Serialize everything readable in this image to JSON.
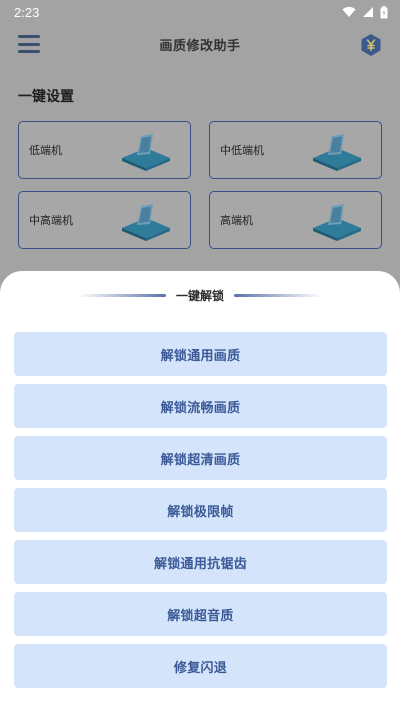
{
  "status_bar": {
    "time": "2:23"
  },
  "app_bar": {
    "title": "画质修改助手"
  },
  "section": {
    "title": "一键设置"
  },
  "devices": [
    {
      "label": "低端机"
    },
    {
      "label": "中低端机"
    },
    {
      "label": "中高端机"
    },
    {
      "label": "高端机"
    }
  ],
  "sheet": {
    "title": "一键解锁",
    "actions": [
      {
        "label": "解锁通用画质"
      },
      {
        "label": "解锁流畅画质"
      },
      {
        "label": "解锁超清画质"
      },
      {
        "label": "解锁极限帧"
      },
      {
        "label": "解锁通用抗锯齿"
      },
      {
        "label": "解锁超音质"
      },
      {
        "label": "修复闪退"
      }
    ]
  },
  "icons": {
    "status": [
      "wifi-icon",
      "signal-icon",
      "battery-icon"
    ],
    "menu": "hamburger-menu-icon",
    "support": "yen-hexagon-icon"
  },
  "colors": {
    "accent": "#3c5a98",
    "button_bg": "#d4e5fb",
    "card_border": "#3a4f86",
    "overlay": "#a3a3a3"
  }
}
